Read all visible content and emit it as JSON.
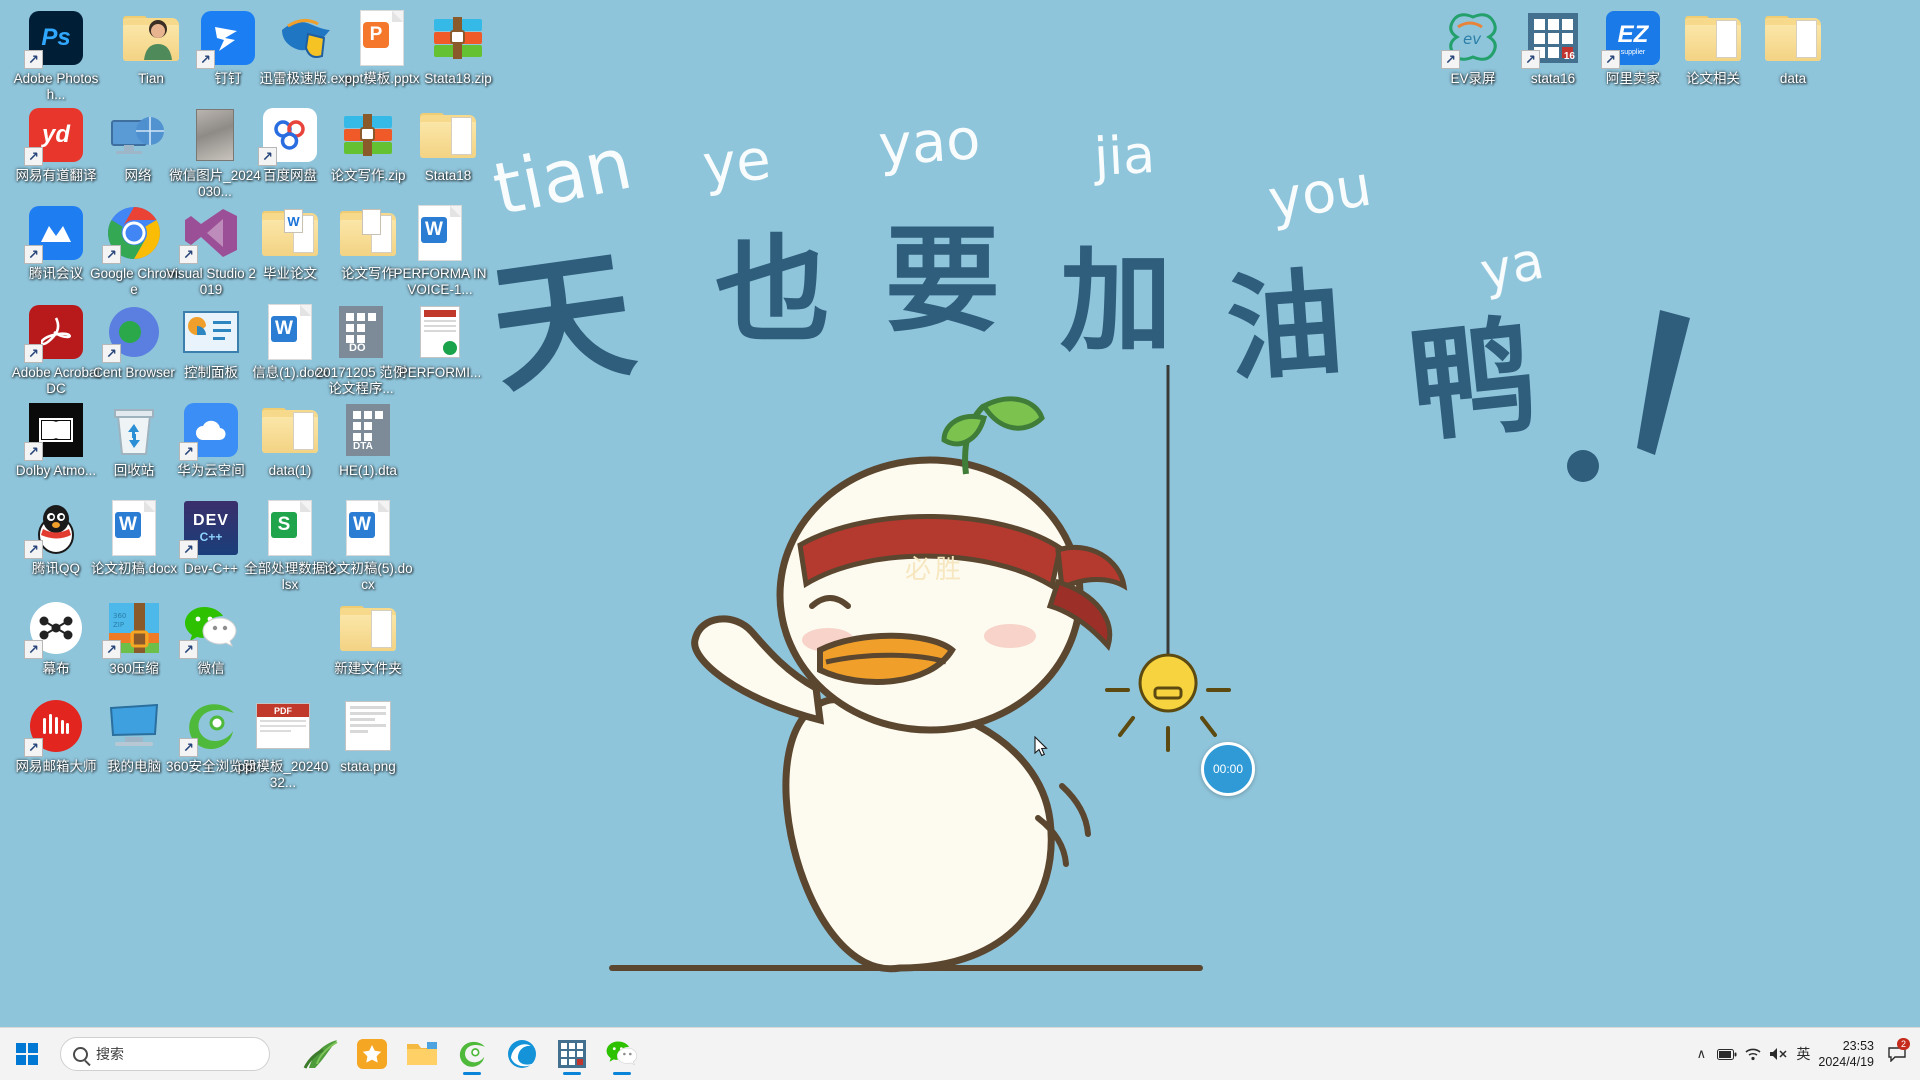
{
  "desktop": {
    "wallpaper": {
      "background_color": "#8fc5db",
      "pinyin_words": [
        "tian",
        "ye",
        "yao",
        "jia",
        "you",
        "ya"
      ],
      "characters": [
        "天",
        "也",
        "要",
        "加",
        "油",
        "鸭",
        "！"
      ],
      "phrase": "天也要加油鸭！",
      "character_color": "#2f5d7c",
      "mascot": "cheering-duck-with-headband"
    },
    "icons_left": [
      {
        "label": "Adobe Photosh...",
        "type": "app-shortcut",
        "icon": "photoshop-icon",
        "shortcut": true
      },
      {
        "label": "Tian",
        "type": "folder",
        "icon": "user-folder-icon",
        "shortcut": false
      },
      {
        "label": "钉钉",
        "type": "app-shortcut",
        "icon": "dingtalk-icon",
        "shortcut": true
      },
      {
        "label": "迅雷极速版.exe",
        "type": "executable",
        "icon": "thunder-bird-icon",
        "shortcut": false
      },
      {
        "label": "ppt模板.pptx",
        "type": "file",
        "icon": "wps-powerpoint-icon",
        "shortcut": false
      },
      {
        "label": "Stata18.zip",
        "type": "archive",
        "icon": "winrar-icon",
        "shortcut": false
      },
      {
        "label": "网易有道翻译",
        "type": "app-shortcut",
        "icon": "youdao-icon",
        "shortcut": true
      },
      {
        "label": "网络",
        "type": "system",
        "icon": "network-icon",
        "shortcut": false
      },
      {
        "label": "微信图片_2024030...",
        "type": "image",
        "icon": "photo-thumbnail-icon",
        "shortcut": false
      },
      {
        "label": "百度网盘",
        "type": "app-shortcut",
        "icon": "baidu-netdisk-icon",
        "shortcut": true
      },
      {
        "label": "论文写作.zip",
        "type": "archive",
        "icon": "winrar-icon",
        "shortcut": false
      },
      {
        "label": "Stata18",
        "type": "folder",
        "icon": "folder-icon",
        "shortcut": false
      },
      {
        "label": "腾讯会议",
        "type": "app-shortcut",
        "icon": "tencent-meeting-icon",
        "shortcut": true
      },
      {
        "label": "Google Chrome",
        "type": "app-shortcut",
        "icon": "chrome-icon",
        "shortcut": true
      },
      {
        "label": "Visual Studio 2019",
        "type": "app-shortcut",
        "icon": "visual-studio-icon",
        "shortcut": true
      },
      {
        "label": "毕业论文",
        "type": "folder",
        "icon": "folder-docs-icon",
        "shortcut": false
      },
      {
        "label": "论文写作",
        "type": "folder",
        "icon": "folder-docs-icon",
        "shortcut": false
      },
      {
        "label": "PERFORMA INVOICE-1...",
        "type": "file",
        "icon": "word-doc-icon",
        "shortcut": false
      },
      {
        "label": "Adobe Acrobat DC",
        "type": "app-shortcut",
        "icon": "acrobat-icon",
        "shortcut": true
      },
      {
        "label": "Cent Browser",
        "type": "app-shortcut",
        "icon": "cent-browser-icon",
        "shortcut": true
      },
      {
        "label": "控制面板",
        "type": "system",
        "icon": "control-panel-icon",
        "shortcut": false
      },
      {
        "label": "信息(1).docx",
        "type": "file",
        "icon": "word-doc-icon",
        "shortcut": false
      },
      {
        "label": "20171205 范例论文程序...",
        "type": "file",
        "icon": "do-file-icon",
        "shortcut": false
      },
      {
        "label": "PERFORMI...",
        "type": "file",
        "icon": "pdf-preview-icon",
        "shortcut": false
      },
      {
        "label": "Dolby Atmo...",
        "type": "app-shortcut",
        "icon": "dolby-icon",
        "shortcut": true
      },
      {
        "label": "回收站",
        "type": "system",
        "icon": "recycle-bin-icon",
        "shortcut": false
      },
      {
        "label": "华为云空间",
        "type": "app-shortcut",
        "icon": "huawei-cloud-icon",
        "shortcut": true
      },
      {
        "label": "data(1)",
        "type": "folder",
        "icon": "folder-icon",
        "shortcut": false
      },
      {
        "label": "HE(1).dta",
        "type": "file",
        "icon": "dta-file-icon",
        "shortcut": false
      },
      {
        "label": "腾讯QQ",
        "type": "app-shortcut",
        "icon": "qq-penguin-icon",
        "shortcut": true
      },
      {
        "label": "论文初稿.docx",
        "type": "file",
        "icon": "word-doc-icon",
        "shortcut": false
      },
      {
        "label": "Dev-C++",
        "type": "app-shortcut",
        "icon": "devcpp-icon",
        "shortcut": true
      },
      {
        "label": "全部处理数据.xlsx",
        "type": "file",
        "icon": "wps-excel-icon",
        "shortcut": false
      },
      {
        "label": "论文初稿(5).docx",
        "type": "file",
        "icon": "word-doc-icon",
        "shortcut": false
      },
      {
        "label": "幕布",
        "type": "app-shortcut",
        "icon": "mubu-icon",
        "shortcut": true
      },
      {
        "label": "360压缩",
        "type": "app-shortcut",
        "icon": "360zip-icon",
        "shortcut": true
      },
      {
        "label": "微信",
        "type": "app-shortcut",
        "icon": "wechat-icon",
        "shortcut": true
      },
      {
        "label": "新建文件夹",
        "type": "folder",
        "icon": "folder-icon",
        "shortcut": false
      },
      {
        "label": "网易邮箱大师",
        "type": "app-shortcut",
        "icon": "netease-mail-icon",
        "shortcut": true
      },
      {
        "label": "我的电脑",
        "type": "system",
        "icon": "this-pc-icon",
        "shortcut": false
      },
      {
        "label": "360安全浏览器",
        "type": "app-shortcut",
        "icon": "360browser-icon",
        "shortcut": true
      },
      {
        "label": "ppt模板_2024032...",
        "type": "file",
        "icon": "pdf-preview-icon",
        "shortcut": false
      },
      {
        "label": "stata.png",
        "type": "image",
        "icon": "png-preview-icon",
        "shortcut": false
      }
    ],
    "icons_right": [
      {
        "label": "EV录屏",
        "type": "app-shortcut",
        "icon": "ev-recorder-icon",
        "shortcut": true
      },
      {
        "label": "stata16",
        "type": "app-shortcut",
        "icon": "stata16-icon",
        "shortcut": true
      },
      {
        "label": "阿里卖家",
        "type": "app-shortcut",
        "icon": "ali-supplier-icon",
        "shortcut": true
      },
      {
        "label": "论文相关",
        "type": "folder",
        "icon": "folder-docs-icon",
        "shortcut": false
      },
      {
        "label": "data",
        "type": "folder",
        "icon": "folder-docs-icon",
        "shortcut": false
      }
    ],
    "timer_widget": {
      "value": "00:00",
      "color": "#2f9ad6"
    }
  },
  "taskbar": {
    "start_label": "start",
    "search": {
      "value": "搜索",
      "placeholder": "搜索"
    },
    "pinned_apps": [
      {
        "name": "mubu-bamboo-icon",
        "label": "幕布",
        "active": false
      },
      {
        "name": "star-app-icon",
        "label": "收藏",
        "active": false
      },
      {
        "name": "file-explorer-icon",
        "label": "文件资源管理器",
        "active": false
      },
      {
        "name": "ie-browser-icon",
        "label": "360安全浏览器",
        "active": true
      },
      {
        "name": "edge-browser-icon",
        "label": "Microsoft Edge",
        "active": false
      },
      {
        "name": "stata-icon",
        "label": "Stata",
        "active": true
      },
      {
        "name": "wechat-icon",
        "label": "微信",
        "active": true
      }
    ],
    "tray": {
      "chevron": "∧",
      "items": [
        "battery-icon",
        "wifi-icon",
        "volume-muted-icon"
      ],
      "ime_label": "英",
      "clock_time": "23:53",
      "clock_date": "2024/4/19",
      "notification_count": "2"
    }
  }
}
